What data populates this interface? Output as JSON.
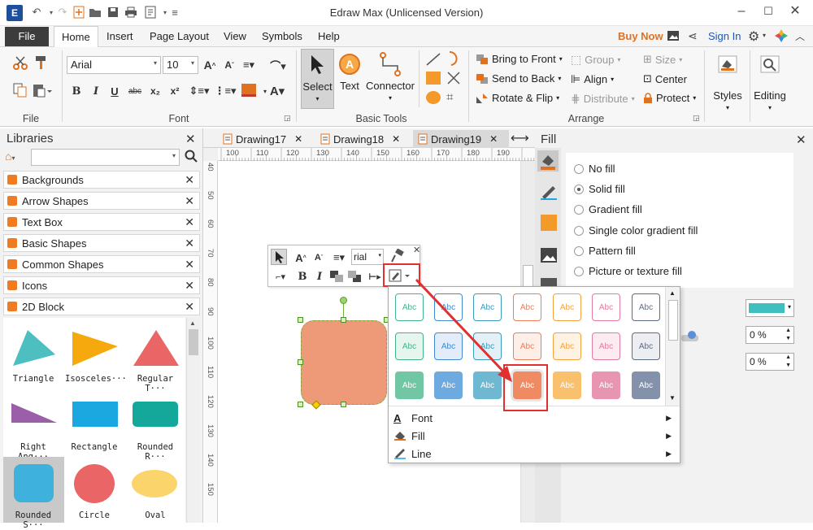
{
  "app": {
    "title": "Edraw Max (Unlicensed Version)"
  },
  "menu": {
    "file": "File",
    "home": "Home",
    "insert": "Insert",
    "page_layout": "Page Layout",
    "view": "View",
    "symbols": "Symbols",
    "help": "Help",
    "buy_now": "Buy Now",
    "sign_in": "Sign In"
  },
  "ribbon": {
    "file_group": "File",
    "font_group": "Font",
    "font_name": "Arial",
    "font_size": "10",
    "basic_tools_group": "Basic Tools",
    "select": "Select",
    "text": "Text",
    "connector": "Connector",
    "arrange_group": "Arrange",
    "bring_to_front": "Bring to Front",
    "send_to_back": "Send to Back",
    "rotate_flip": "Rotate & Flip",
    "group": "Group",
    "align": "Align",
    "distribute": "Distribute",
    "size": "Size",
    "center": "Center",
    "protect": "Protect",
    "styles": "Styles",
    "editing": "Editing"
  },
  "libraries": {
    "title": "Libraries",
    "items": [
      "Backgrounds",
      "Arrow Shapes",
      "Text Box",
      "Basic Shapes",
      "Common Shapes",
      "Icons",
      "2D Block"
    ],
    "shapes": [
      "Triangle",
      "Isosceles···",
      "Regular T···",
      "Right Ang···",
      "Rectangle",
      "Rounded R···",
      "Rounded S···",
      "Circle",
      "Oval"
    ]
  },
  "tabs": [
    "Drawing17",
    "Drawing18",
    "Drawing19"
  ],
  "ruler": {
    "h": [
      "100",
      "110",
      "120",
      "130",
      "140",
      "150",
      "160",
      "170",
      "180",
      "190"
    ],
    "v": [
      "40",
      "50",
      "60",
      "70",
      "80",
      "90",
      "100",
      "110",
      "120",
      "130",
      "140",
      "150"
    ]
  },
  "floatbar": {
    "font": "rial"
  },
  "fill_panel": {
    "title": "Fill",
    "options": [
      "No fill",
      "Solid fill",
      "Gradient fill",
      "Single color gradient fill",
      "Pattern fill",
      "Picture or texture fill"
    ],
    "selected": "Solid fill",
    "color": "#3fbfbf",
    "pct1": "0 %",
    "pct2": "0 %"
  },
  "style_popup": {
    "swatch_label": "Abc",
    "menu": [
      "Font",
      "Fill",
      "Line"
    ]
  },
  "colors": {
    "accent": "#f07b22",
    "shape_fill": "#ee9a78",
    "highlight": "#e03030"
  }
}
